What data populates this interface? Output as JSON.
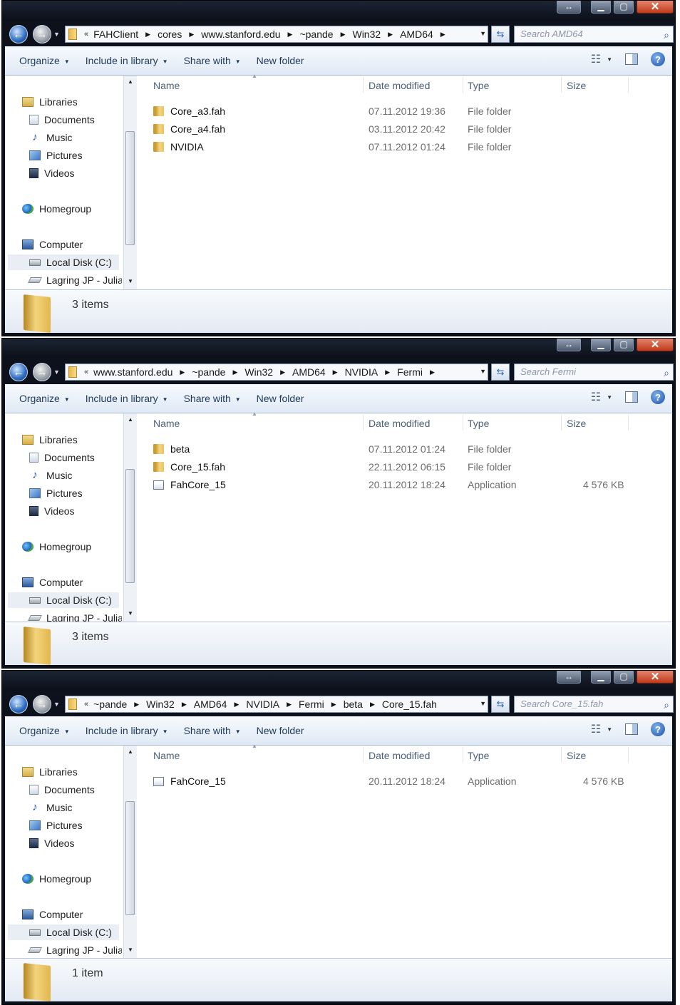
{
  "toolbar": {
    "organize": "Organize",
    "include": "Include in library",
    "share": "Share with",
    "new_folder": "New folder"
  },
  "nav": {
    "libraries": "Libraries",
    "documents": "Documents",
    "music": "Music",
    "pictures": "Pictures",
    "videos": "Videos",
    "homegroup": "Homegroup",
    "computer": "Computer",
    "local_disk": "Local Disk (C:)",
    "lagring": "Lagring JP - Julia"
  },
  "columns": {
    "name": "Name",
    "date": "Date modified",
    "type": "Type",
    "size": "Size"
  },
  "windows": [
    {
      "breadcrumbs": [
        "FAHClient",
        "cores",
        "www.stanford.edu",
        "~pande",
        "Win32",
        "AMD64"
      ],
      "search_placeholder": "Search AMD64",
      "status": "3 items",
      "files": [
        {
          "name": "Core_a3.fah",
          "date": "07.11.2012 19:36",
          "type": "File folder",
          "size": "",
          "icon": "folder"
        },
        {
          "name": "Core_a4.fah",
          "date": "03.11.2012 20:42",
          "type": "File folder",
          "size": "",
          "icon": "folder"
        },
        {
          "name": "NVIDIA",
          "date": "07.11.2012 01:24",
          "type": "File folder",
          "size": "",
          "icon": "folder"
        }
      ]
    },
    {
      "breadcrumbs": [
        "www.stanford.edu",
        "~pande",
        "Win32",
        "AMD64",
        "NVIDIA",
        "Fermi"
      ],
      "search_placeholder": "Search Fermi",
      "status": "3 items",
      "files": [
        {
          "name": "beta",
          "date": "07.11.2012 01:24",
          "type": "File folder",
          "size": "",
          "icon": "folder"
        },
        {
          "name": "Core_15.fah",
          "date": "22.11.2012 06:15",
          "type": "File folder",
          "size": "",
          "icon": "folder"
        },
        {
          "name": "FahCore_15",
          "date": "20.11.2012 18:24",
          "type": "Application",
          "size": "4 576 KB",
          "icon": "application"
        }
      ]
    },
    {
      "breadcrumbs": [
        "~pande",
        "Win32",
        "AMD64",
        "NVIDIA",
        "Fermi",
        "beta",
        "Core_15.fah"
      ],
      "search_placeholder": "Search Core_15.fah",
      "status": "1 item",
      "files": [
        {
          "name": "FahCore_15",
          "date": "20.11.2012 18:24",
          "type": "Application",
          "size": "4 576 KB",
          "icon": "application"
        }
      ]
    }
  ]
}
